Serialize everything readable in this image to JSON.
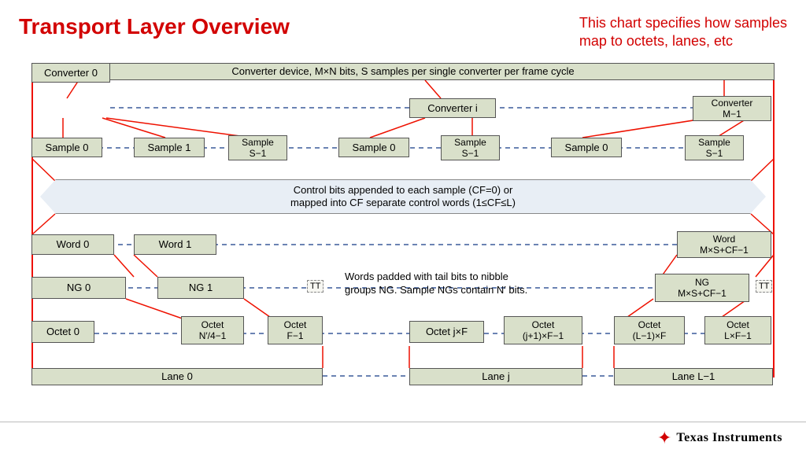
{
  "title": "Transport Layer Overview",
  "subtitle_l1": "This chart specifies how samples",
  "subtitle_l2": "map to octets, lanes, etc",
  "top_bar": "Converter device, M×N bits, S samples per single converter per frame cycle",
  "converters": {
    "c0": "Converter 0",
    "ci": "Converter i",
    "cm": "Converter\nM−1"
  },
  "samples": {
    "s0": "Sample 0",
    "s1": "Sample 1",
    "ss1": "Sample\nS−1",
    "s0b": "Sample 0",
    "ss1b": "Sample\nS−1",
    "s0c": "Sample 0",
    "ss1c": "Sample\nS−1"
  },
  "ctrl_band_l1": "Control bits appended to each sample (CF=0) or",
  "ctrl_band_l2": "mapped into CF separate control words (1≤CF≤L)",
  "words": {
    "w0": "Word 0",
    "w1": "Word 1",
    "wlast": "Word\nM×S+CF−1"
  },
  "ngs": {
    "ng0": "NG 0",
    "ng1": "NG 1",
    "nglast": "NG\nM×S+CF−1",
    "tt": "TT"
  },
  "ng_note_l1": "Words padded with tail bits to nibble",
  "ng_note_l2": "groups NG. Sample NGs contain N′ bits.",
  "octets": {
    "o0": "Octet 0",
    "o_n4": "Octet\nN′/4−1",
    "o_f1": "Octet\nF−1",
    "o_jf": "Octet j×F",
    "o_j1f": "Octet\n(j+1)×F−1",
    "o_l1f": "Octet\n(L−1)×F",
    "o_lf1": "Octet\nL×F−1"
  },
  "lanes": {
    "l0": "Lane 0",
    "lj": "Lane j",
    "ll1": "Lane L−1"
  },
  "footer": "Texas Instruments"
}
